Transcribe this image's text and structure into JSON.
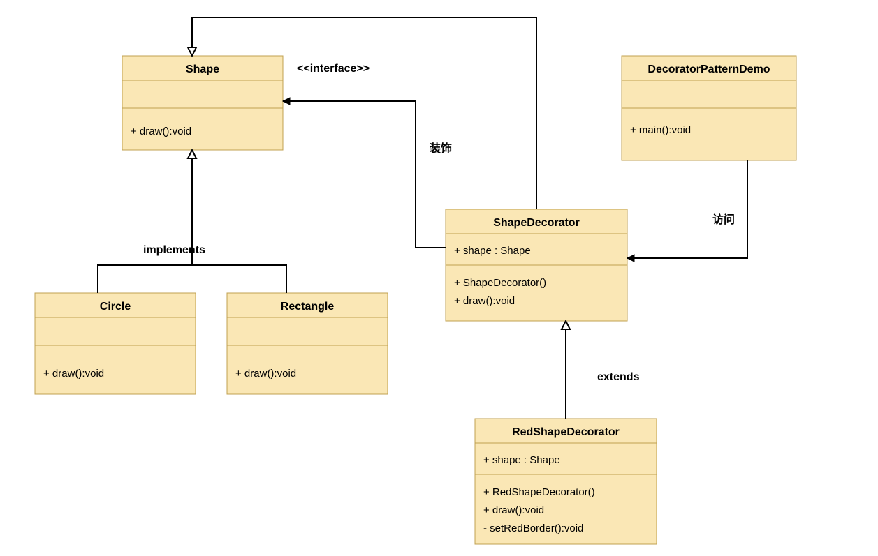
{
  "shape": {
    "name": "Shape",
    "stereotype": "<<interface>>",
    "method": "+ draw():void"
  },
  "demo": {
    "name": "DecoratorPatternDemo",
    "method": "+ main():void"
  },
  "circle": {
    "name": "Circle",
    "method": "+ draw():void"
  },
  "rectangle": {
    "name": "Rectangle",
    "method": "+ draw():void"
  },
  "decorator": {
    "name": "ShapeDecorator",
    "attr": "+ shape : Shape",
    "m1": "+ ShapeDecorator()",
    "m2": "+ draw():void"
  },
  "red": {
    "name": "RedShapeDecorator",
    "attr": "+ shape : Shape",
    "m1": "+ RedShapeDecorator()",
    "m2": "+ draw():void",
    "m3": "- setRedBorder():void"
  },
  "labels": {
    "implements": "implements",
    "decorates": "装饰",
    "access": "访问",
    "extends": "extends"
  }
}
